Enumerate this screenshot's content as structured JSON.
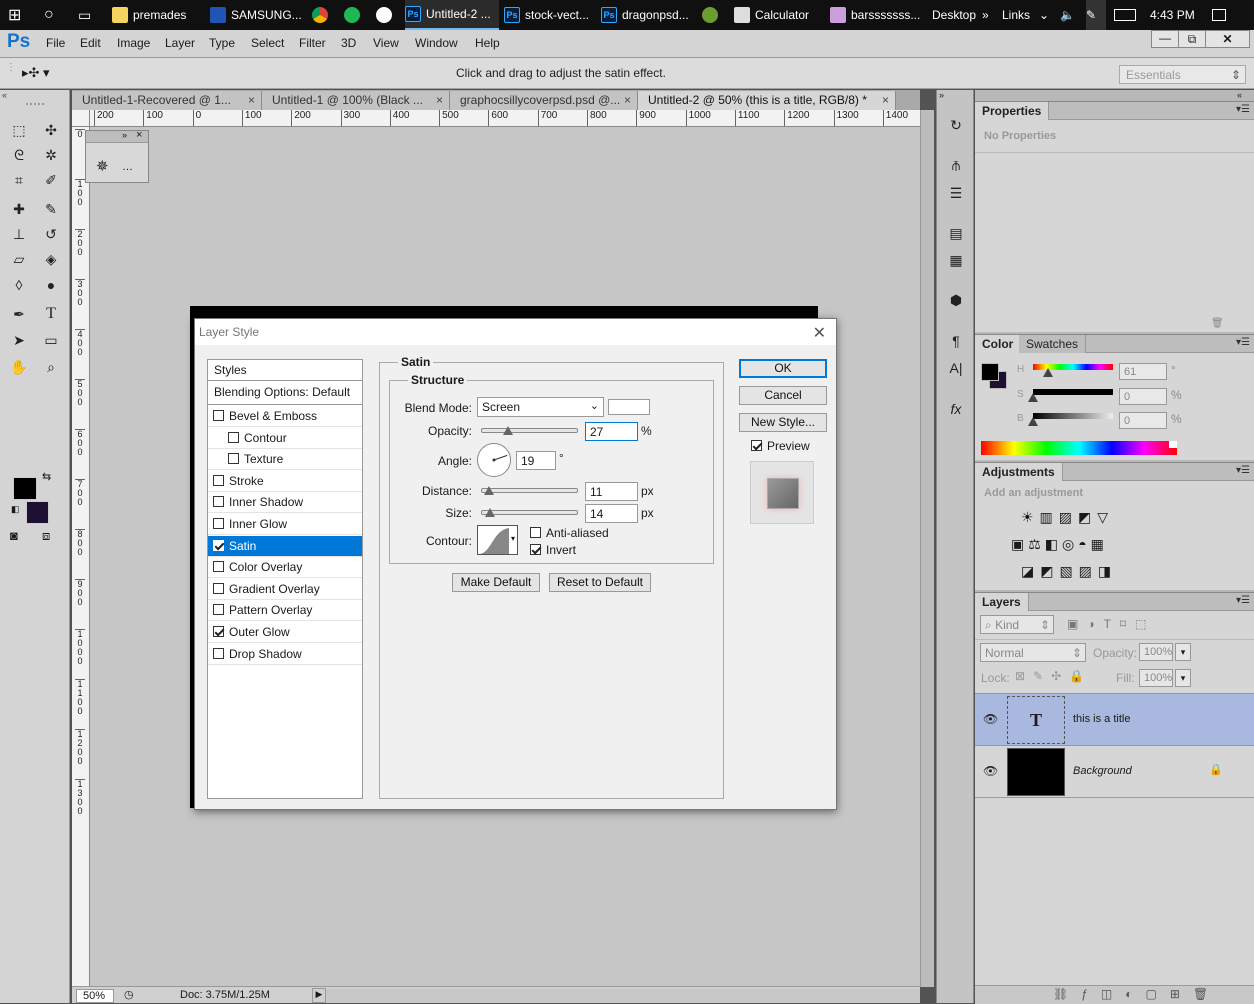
{
  "taskbar": {
    "items": [
      "premades",
      "SAMSUNG...",
      "Untitled-2 ...",
      "stock-vect...",
      "dragonpsd...",
      "Calculator",
      "barsssssss..."
    ],
    "desktop": "Desktop",
    "links": "Links",
    "time": "4:43 PM"
  },
  "app": {
    "logo": "Ps"
  },
  "menu": [
    "File",
    "Edit",
    "Image",
    "Layer",
    "Type",
    "Select",
    "Filter",
    "3D",
    "View",
    "Window",
    "Help"
  ],
  "options": {
    "hint": "Click and drag to adjust the satin effect.",
    "workspace": "Essentials"
  },
  "tabs": [
    {
      "label": "Untitled-1-Recovered @ 1..."
    },
    {
      "label": "Untitled-1 @ 100% (Black ..."
    },
    {
      "label": "graphocsillycoverpsd.psd @..."
    },
    {
      "label": "Untitled-2 @ 50% (this is a title, RGB/8) *"
    }
  ],
  "ruler_h": [
    "200",
    "100",
    "0",
    "100",
    "200",
    "300",
    "400",
    "500",
    "600",
    "700",
    "800",
    "900",
    "1000",
    "1100",
    "1200",
    "1300",
    "1400"
  ],
  "ruler_v": [
    "0",
    "1\n0\n0",
    "2\n0\n0",
    "3\n0\n0",
    "4\n0\n0",
    "5\n0\n0",
    "6\n0\n0",
    "7\n0\n0",
    "8\n0\n0",
    "9\n0\n0",
    "1\n0\n0\n0",
    "1\n1\n0\n0",
    "1\n2\n0\n0",
    "1\n3\n0\n0"
  ],
  "status": {
    "zoom": "50%",
    "doc": "Doc: 3.75M/1.25M"
  },
  "dialog": {
    "title": "Layer Style",
    "styles_header": "Styles",
    "blending": "Blending Options: Default",
    "items": [
      {
        "label": "Bevel & Emboss",
        "checked": false,
        "indent": false,
        "selected": false
      },
      {
        "label": "Contour",
        "checked": false,
        "indent": true,
        "selected": false
      },
      {
        "label": "Texture",
        "checked": false,
        "indent": true,
        "selected": false
      },
      {
        "label": "Stroke",
        "checked": false,
        "indent": false,
        "selected": false
      },
      {
        "label": "Inner Shadow",
        "checked": false,
        "indent": false,
        "selected": false
      },
      {
        "label": "Inner Glow",
        "checked": false,
        "indent": false,
        "selected": false
      },
      {
        "label": "Satin",
        "checked": true,
        "indent": false,
        "selected": true
      },
      {
        "label": "Color Overlay",
        "checked": false,
        "indent": false,
        "selected": false
      },
      {
        "label": "Gradient Overlay",
        "checked": false,
        "indent": false,
        "selected": false
      },
      {
        "label": "Pattern Overlay",
        "checked": false,
        "indent": false,
        "selected": false
      },
      {
        "label": "Outer Glow",
        "checked": true,
        "indent": false,
        "selected": false
      },
      {
        "label": "Drop Shadow",
        "checked": false,
        "indent": false,
        "selected": false
      }
    ],
    "section": "Satin",
    "structure": "Structure",
    "blend_mode_label": "Blend Mode:",
    "blend_mode": "Screen",
    "opacity_label": "Opacity:",
    "opacity": "27",
    "opacity_fraction": 0.27,
    "pct": "%",
    "angle_label": "Angle:",
    "angle": "19",
    "deg": "°",
    "distance_label": "Distance:",
    "distance": "11",
    "size_label": "Size:",
    "size": "14",
    "px": "px",
    "contour_label": "Contour:",
    "anti_aliased": "Anti-aliased",
    "invert": "Invert",
    "make_default": "Make Default",
    "reset_default": "Reset to Default",
    "ok": "OK",
    "cancel": "Cancel",
    "new_style": "New Style...",
    "preview": "Preview"
  },
  "properties": {
    "tab": "Properties",
    "empty": "No Properties"
  },
  "color": {
    "tabs": [
      "Color",
      "Swatches"
    ],
    "h_label": "H",
    "h": "61",
    "h_unit": "°",
    "s_label": "S",
    "s": "0",
    "s_unit": "%",
    "b_label": "B",
    "b": "0",
    "b_unit": "%",
    "foreground": "#000000",
    "background": "#1e1033"
  },
  "adjustments": {
    "tab": "Adjustments",
    "hint": "Add an adjustment"
  },
  "layers": {
    "tab": "Layers",
    "kind": "Kind",
    "mode": "Normal",
    "opacity_label": "Opacity:",
    "opacity": "100%",
    "lock_label": "Lock:",
    "fill_label": "Fill:",
    "fill": "100%",
    "items": [
      {
        "name": "this is a title",
        "type": "text",
        "selected": true
      },
      {
        "name": "Background",
        "type": "fill",
        "selected": false
      }
    ]
  }
}
